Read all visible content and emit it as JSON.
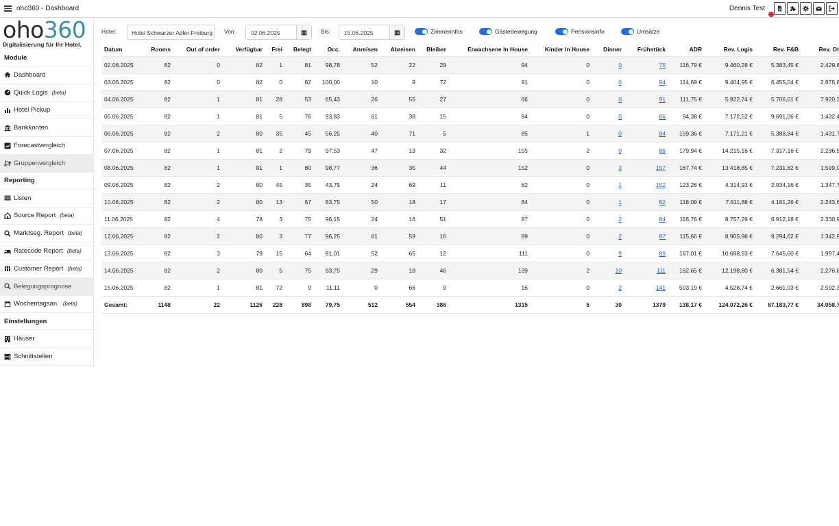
{
  "app": {
    "title": "oho360 - Dashboard",
    "user": "Dennis Test"
  },
  "top_icons": [
    "document-icon",
    "puzzle-icon",
    "gear-icon",
    "envelope-icon",
    "logout-icon"
  ],
  "logo": {
    "word_a": "oho",
    "word_b": "360",
    "tagline": "Digitalisierung für Ihr Hotel."
  },
  "sidebar": {
    "sections": {
      "module": "Module",
      "reporting": "Reporting",
      "settings": "Einstellungen"
    },
    "items": {
      "dashboard": "Dashboard",
      "quicklogis": "Quick Logis",
      "pickup": "Hotel Pickup",
      "bank": "Bankkonten",
      "forecast": "Forecastvergleich",
      "groups": "Gruppenvergleich",
      "lists": "Listen",
      "source": "Source Report",
      "market": "Marktseg. Report",
      "ratecode": "Ratecode Report",
      "customer": "Customer Report",
      "prognosis": "Belegungsprognose",
      "weekday": "Wochentagsan.",
      "houses": "Häuser",
      "interfaces": "Schnittstellen"
    },
    "beta": "(beta)"
  },
  "filters": {
    "hotel_label": "Hotel:",
    "hotel_value": "Hotel Schwarzer Adler Freiburg",
    "from_label": "Von:",
    "from_value": "02.06.2025",
    "to_label": "Bis:",
    "to_value": "15.06.2025",
    "toggles": [
      "Zimmerinfos",
      "Gästebewegung",
      "Pensionsinfo",
      "Umsätze"
    ]
  },
  "table": {
    "headers": [
      "Datum",
      "Rooms",
      "Out of order",
      "Verfügbar",
      "Frei",
      "Belegt",
      "Occ.",
      "Anreisen",
      "Abreisen",
      "Bleiber",
      "Erwachsene In House",
      "Kinder In House",
      "Dinner",
      "Frühstück",
      "ADR",
      "Rev. Logis",
      "Rev. F&B",
      "Rev. Other"
    ],
    "rows": [
      [
        "02.06.2025",
        "82",
        "0",
        "82",
        "1",
        "81",
        "98,78",
        "52",
        "22",
        "29",
        "94",
        "0",
        "0",
        "75",
        "116,79 €",
        "9.460,28 €",
        "5.383,45 €",
        "2.429,83 €"
      ],
      [
        "03.06.2025",
        "82",
        "0",
        "82",
        "0",
        "82",
        "100,00",
        "10",
        "9",
        "72",
        "91",
        "0",
        "0",
        "94",
        "114,69 €",
        "9.404,95 €",
        "6.455,04 €",
        "2.876,82 €"
      ],
      [
        "04.06.2025",
        "82",
        "1",
        "81",
        "28",
        "53",
        "65,43",
        "26",
        "55",
        "27",
        "66",
        "0",
        "0",
        "91",
        "111,75 €",
        "5.922,74 €",
        "5.706,01 €",
        "7.920,34 €"
      ],
      [
        "05.06.2025",
        "82",
        "1",
        "81",
        "5",
        "76",
        "93,83",
        "61",
        "38",
        "15",
        "84",
        "0",
        "0",
        "66",
        "94,38 €",
        "7.172,52 €",
        "9.691,06 €",
        "1.432,41 €"
      ],
      [
        "06.06.2025",
        "82",
        "2",
        "80",
        "35",
        "45",
        "56,25",
        "40",
        "71",
        "5",
        "85",
        "1",
        "0",
        "84",
        "159,36 €",
        "7.171,21 €",
        "5.388,84 €",
        "1.431,77 €"
      ],
      [
        "07.06.2025",
        "82",
        "1",
        "81",
        "2",
        "79",
        "97,53",
        "47",
        "13",
        "32",
        "155",
        "2",
        "0",
        "86",
        "179,94 €",
        "14.215,16 €",
        "7.317,16 €",
        "2.236,51 €"
      ],
      [
        "08.06.2025",
        "82",
        "1",
        "81",
        "1",
        "80",
        "98,77",
        "36",
        "35",
        "44",
        "152",
        "0",
        "3",
        "157",
        "167,74 €",
        "13.418,85 €",
        "7.231,82 €",
        "1.599,00 €"
      ],
      [
        "09.06.2025",
        "82",
        "2",
        "80",
        "45",
        "35",
        "43,75",
        "24",
        "69",
        "11",
        "62",
        "0",
        "1",
        "152",
        "123,28 €",
        "4.314,93 €",
        "2.934,16 €",
        "1.347,75 €"
      ],
      [
        "10.06.2025",
        "82",
        "2",
        "80",
        "13",
        "67",
        "83,75",
        "50",
        "18",
        "17",
        "84",
        "0",
        "1",
        "62",
        "118,09 €",
        "7.911,88 €",
        "4.181,26 €",
        "2.243,67 €"
      ],
      [
        "11.06.2025",
        "82",
        "4",
        "78",
        "3",
        "75",
        "96,15",
        "24",
        "16",
        "51",
        "87",
        "0",
        "2",
        "84",
        "116,76 €",
        "8.757,29 €",
        "6.912,18 €",
        "2.330,98 €"
      ],
      [
        "12.06.2025",
        "82",
        "2",
        "80",
        "3",
        "77",
        "96,25",
        "61",
        "59",
        "16",
        "89",
        "0",
        "2",
        "87",
        "115,66 €",
        "8.905,98 €",
        "9.294,62 €",
        "1.342,95 €"
      ],
      [
        "13.06.2025",
        "82",
        "3",
        "79",
        "15",
        "64",
        "81,01",
        "52",
        "65",
        "12",
        "111",
        "0",
        "9",
        "89",
        "167,01 €",
        "10.688,93 €",
        "7.645,60 €",
        "1.997,49 €"
      ],
      [
        "14.06.2025",
        "82",
        "2",
        "80",
        "5",
        "75",
        "93,75",
        "29",
        "18",
        "46",
        "139",
        "2",
        "10",
        "111",
        "162,65 €",
        "12.198,80 €",
        "6.381,54 €",
        "2.276,86 €"
      ],
      [
        "15.06.2025",
        "82",
        "1",
        "81",
        "72",
        "9",
        "11,11",
        "0",
        "66",
        "9",
        "16",
        "0",
        "2",
        "141",
        "503,19 €",
        "4.528,74 €",
        "2.661,03 €",
        "2.592,36 €"
      ]
    ],
    "total": [
      "Gesamt:",
      "1148",
      "22",
      "1126",
      "228",
      "898",
      "79,75",
      "512",
      "554",
      "386",
      "1315",
      "5",
      "30",
      "1379",
      "138,17 €",
      "124.072,26 €",
      "87.183,77 €",
      "34.058,74 €"
    ],
    "link_columns": [
      12,
      13
    ]
  }
}
